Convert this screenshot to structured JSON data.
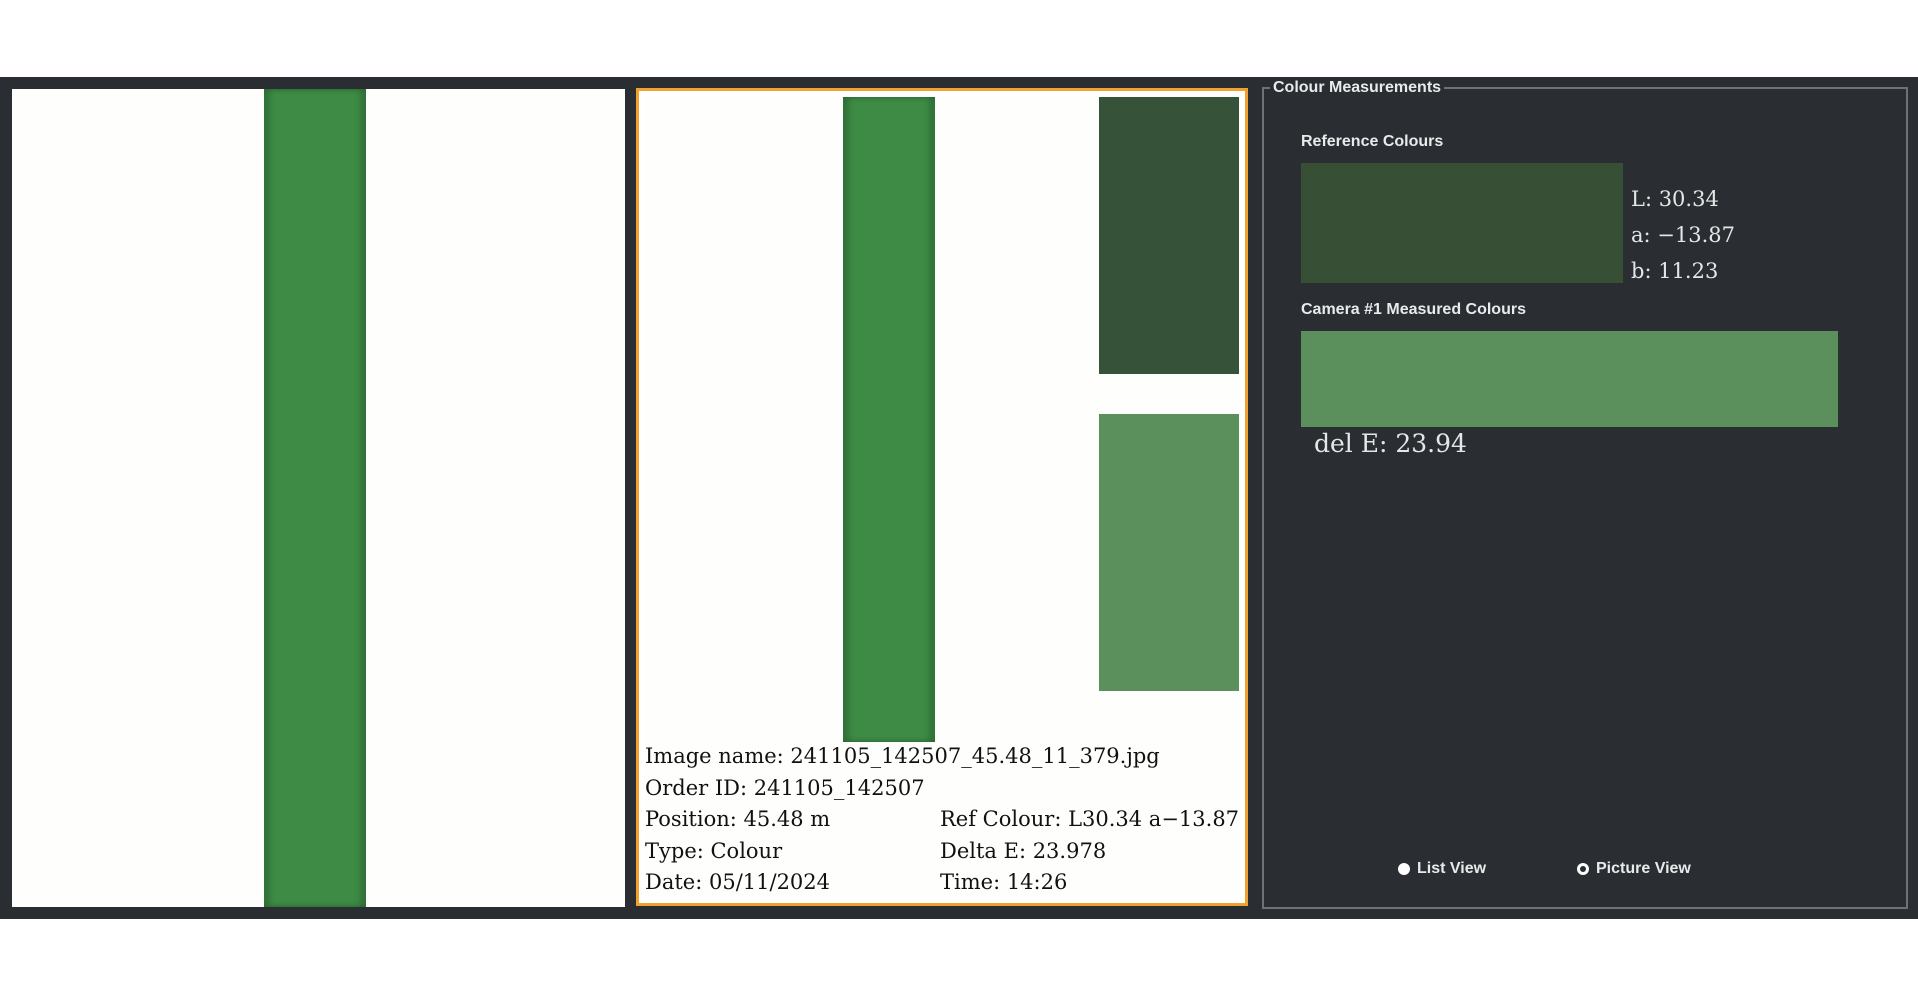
{
  "panels": {
    "measurements_title": "Colour Measurements",
    "reference_label": "Reference Colours",
    "measured_label": "Camera #1 Measured Colours"
  },
  "reference": {
    "color": "#364f35",
    "L": "L: 30.34",
    "a": "a: −13.87",
    "b": "b: 11.23"
  },
  "measured": {
    "color": "#5b905d",
    "delta": "del E: 23.94"
  },
  "image_info": {
    "image_name": "Image name: 241105_142507_45.48_11_379.jpg",
    "order_id": "Order ID: 241105_142507",
    "position": "Position: 45.48 m",
    "ref_colour": "Ref Colour: L30.34 a−13.87",
    "type": "Type: Colour",
    "delta_e": "Delta E: 23.978",
    "date": "Date: 05/11/2024",
    "time": "Time: 14:26"
  },
  "views": {
    "list_view": "List View",
    "picture_view": "Picture View",
    "selected": "Picture View"
  },
  "colors": {
    "background": "#2a2d31",
    "selection_border": "#f0a12f",
    "stripe": "#3d8b45"
  }
}
